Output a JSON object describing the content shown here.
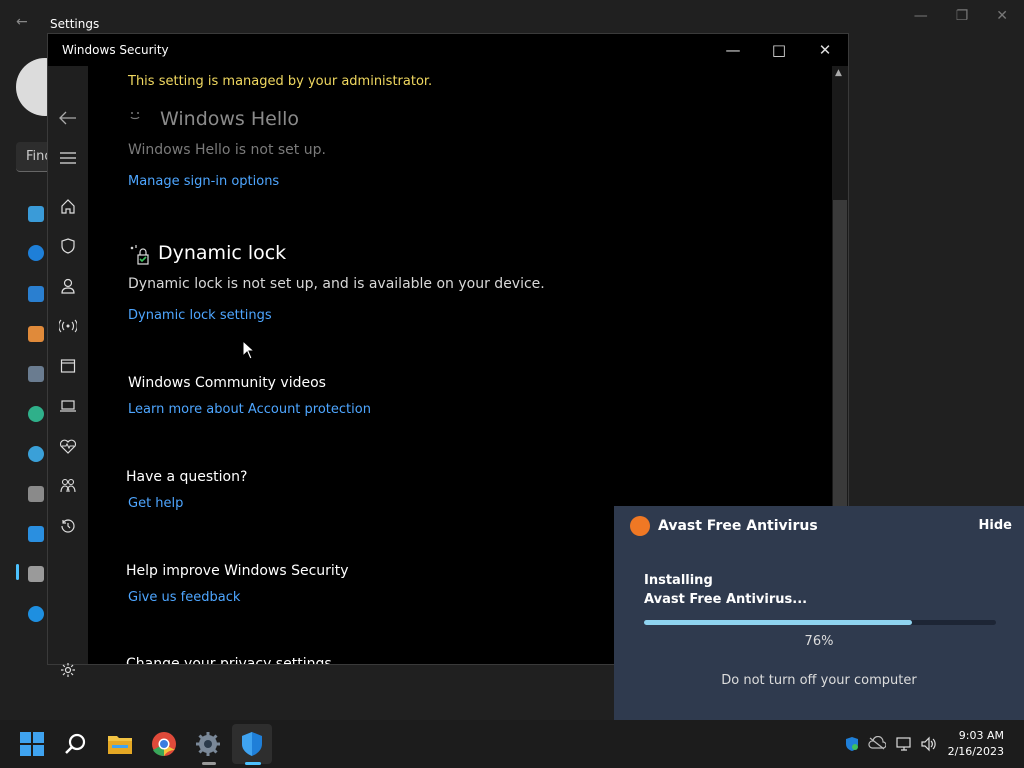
{
  "settings": {
    "title": "Settings",
    "find_text": "Find"
  },
  "windows_security": {
    "title": "Windows Security",
    "managed_notice": "This setting is managed by your administrator.",
    "hello": {
      "heading": "Windows Hello",
      "description": "Windows Hello is not set up.",
      "link": "Manage sign-in options"
    },
    "dynamic_lock": {
      "heading": "Dynamic lock",
      "description": "Dynamic lock is not set up, and is available on your device.",
      "link": "Dynamic lock settings"
    },
    "community": {
      "heading": "Windows Community videos",
      "link": "Learn more about Account protection"
    },
    "question": {
      "heading": "Have a question?",
      "link": "Get help"
    },
    "improve": {
      "heading": "Help improve Windows Security",
      "link": "Give us feedback"
    },
    "privacy": {
      "heading": "Change your privacy settings"
    }
  },
  "avast": {
    "app_name": "Avast Free Antivirus",
    "hide_label": "Hide",
    "status_line1": "Installing",
    "status_line2": "Avast Free Antivirus...",
    "progress_text": "76%",
    "progress_value": 76,
    "warning": "Do not turn off your computer"
  },
  "clock": {
    "time": "9:03 AM",
    "date": "2/16/2023"
  },
  "colors": {
    "link": "#4ea6ff",
    "managed": "#f0d860",
    "avast_bg": "#2f3a4e",
    "accent": "#4cc2ff"
  }
}
